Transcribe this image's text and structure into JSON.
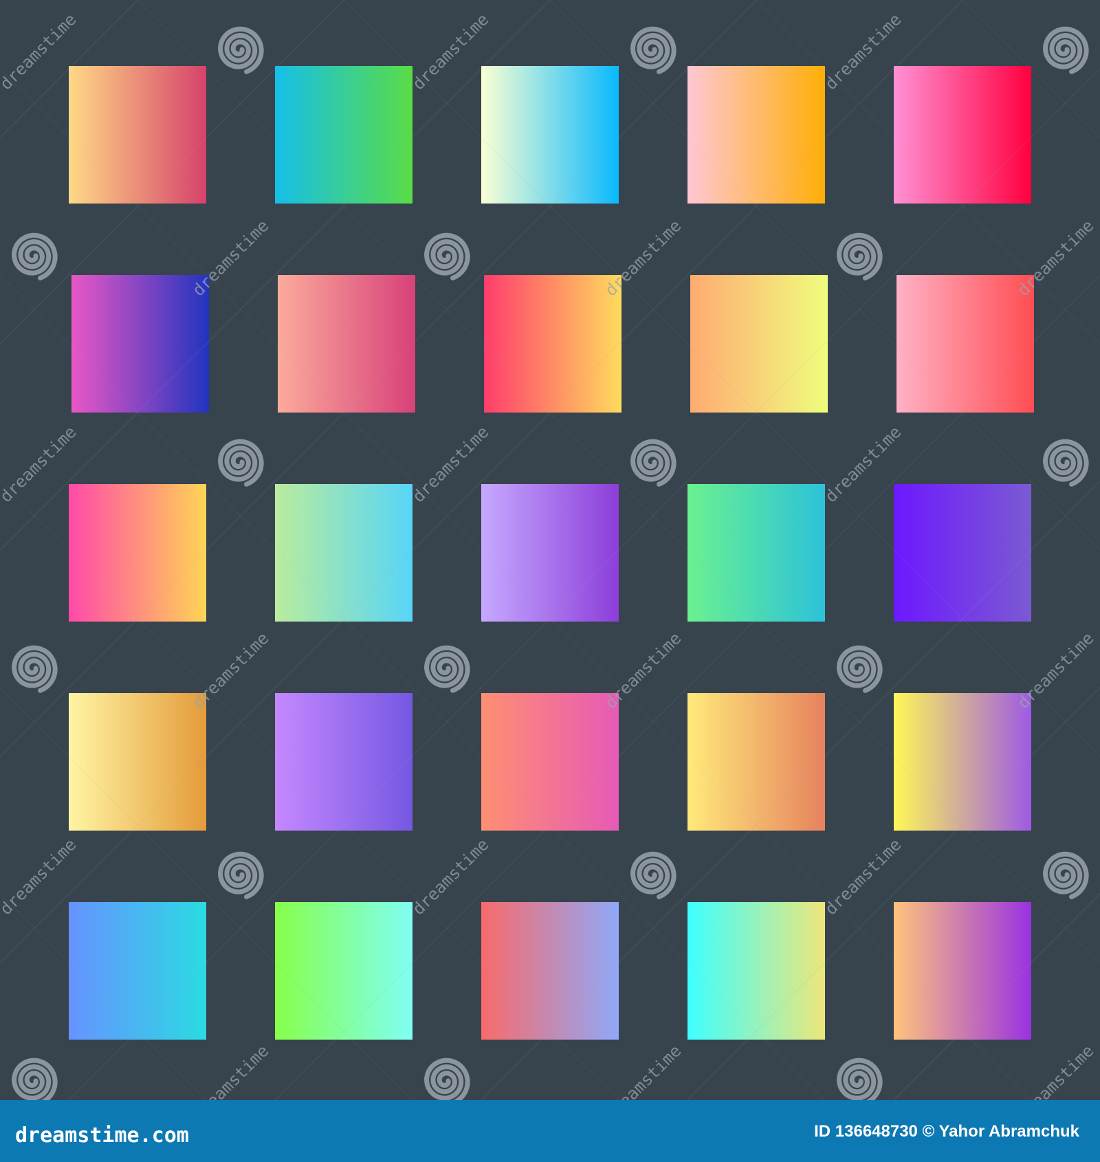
{
  "footer": {
    "brand": "dreamstime.com",
    "image_id": "ID 136648730 © Yahor Abramchuk"
  },
  "watermark": {
    "text": "dreamstime",
    "color": "#9aa3ab"
  },
  "colors": {
    "background": "#37434d",
    "footer": "#0d79b3"
  },
  "swatches": [
    {
      "from": "#ffd986",
      "to": "#d6426b"
    },
    {
      "from": "#15bfe9",
      "to": "#5adc46"
    },
    {
      "from": "#fbffd3",
      "to": "#09b9ff"
    },
    {
      "from": "#ffc7d4",
      "to": "#ffae05"
    },
    {
      "from": "#ff91d4",
      "to": "#ff0040"
    },
    {
      "from": "#e957c6",
      "to": "#2234bf"
    },
    {
      "from": "#fbab9b",
      "to": "#d8417a"
    },
    {
      "from": "#ff3d6d",
      "to": "#ffdb5d"
    },
    {
      "from": "#ffab72",
      "to": "#effd7d"
    },
    {
      "from": "#ffb2c6",
      "to": "#ff4d52"
    },
    {
      "from": "#ff4aa8",
      "to": "#ffd455"
    },
    {
      "from": "#b9ec9d",
      "to": "#58d5f7"
    },
    {
      "from": "#c6a9ff",
      "to": "#8c3ed9"
    },
    {
      "from": "#6af190",
      "to": "#2cc2d9"
    },
    {
      "from": "#6d18ff",
      "to": "#7b5ad2"
    },
    {
      "from": "#fff5a3",
      "to": "#e49b3a"
    },
    {
      "from": "#c588ff",
      "to": "#7558e2"
    },
    {
      "from": "#ff8f72",
      "to": "#e65ab6"
    },
    {
      "from": "#ffea7b",
      "to": "#e6825e"
    },
    {
      "from": "#fff856",
      "to": "#9e5ae4"
    },
    {
      "from": "#6693ff",
      "to": "#2bdbe3"
    },
    {
      "from": "#87ff4a",
      "to": "#7ffff3"
    },
    {
      "from": "#f86b6b",
      "to": "#90a8f8"
    },
    {
      "from": "#3dffff",
      "to": "#eee67a"
    },
    {
      "from": "#ffc47c",
      "to": "#9932e2"
    }
  ]
}
